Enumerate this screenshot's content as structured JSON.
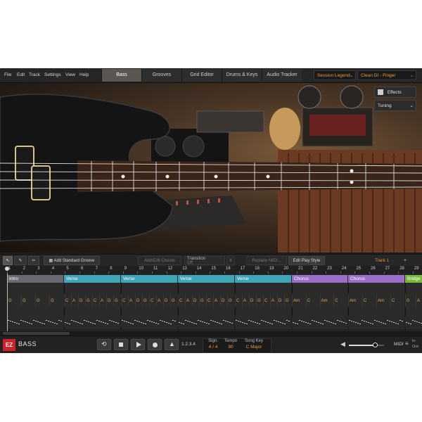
{
  "menu": [
    "File",
    "Edit",
    "Track",
    "Settings",
    "View",
    "Help"
  ],
  "tabs": [
    "Bass",
    "Grooves",
    "Grid Editor",
    "Drums & Keys",
    "Audio Tracker"
  ],
  "active_tab": "Bass",
  "presets": {
    "left": "Session Legend",
    "right": "Clean DI - Finger"
  },
  "stage": {
    "effects_label": "Effects",
    "tuning_label": "Tuning"
  },
  "toolbar": {
    "add_groove": "Add Standard Groove",
    "add_edit_chords": "Add/Edit Chords",
    "transition_label": "Transition",
    "transition_value": "Off",
    "replace_midi": "Replace MIDI...",
    "edit_play_style": "Edit Play Style",
    "track_name": "Track 1",
    "add_track": "+"
  },
  "ruler": [
    "1",
    "2",
    "3",
    "4",
    "5",
    "6",
    "7",
    "8",
    "9",
    "10",
    "11",
    "12",
    "13",
    "14",
    "15",
    "16",
    "17",
    "18",
    "19",
    "20",
    "21",
    "22",
    "23",
    "24",
    "25",
    "26",
    "27",
    "28",
    "29"
  ],
  "sections": [
    {
      "label": "Intro",
      "color": "#6a6a72"
    },
    {
      "label": "Verse",
      "color": "#3fa6b8"
    },
    {
      "label": "Verse",
      "color": "#3fa6b8"
    },
    {
      "label": "Verse",
      "color": "#3fa6b8"
    },
    {
      "label": "Verse",
      "color": "#3fa6b8"
    },
    {
      "label": "Chorus",
      "color": "#9b6fc8"
    },
    {
      "label": "Chorus",
      "color": "#9b6fc8"
    },
    {
      "label": "Bridge",
      "color": "#78b83a"
    }
  ],
  "chords": {
    "intro": [
      "G",
      "G",
      "G",
      "G"
    ],
    "verse": [
      "C",
      "A",
      "D",
      "G",
      "C",
      "A",
      "D",
      "G"
    ],
    "chorus": [
      "Am",
      "C",
      "Am",
      "C"
    ],
    "bridge": [
      "G",
      "A"
    ]
  },
  "transport": {
    "counter": "1.2.3.4",
    "sign_label": "Sign.",
    "sign_value": "4 / 4",
    "tempo_label": "Tempo",
    "tempo_value": "90",
    "key_label": "Song Key",
    "key_value": "C Major",
    "midi_label": "MIDI",
    "in_label": "In",
    "out_label": "Out"
  },
  "brand": {
    "logo": "EZ",
    "product": "BASS",
    "color": "#d0202a"
  },
  "colors": {
    "accent": "#e89a3c",
    "verse": "#3fa6b8",
    "chorus": "#9b6fc8",
    "bridge": "#78b83a",
    "intro": "#6a6a72"
  }
}
